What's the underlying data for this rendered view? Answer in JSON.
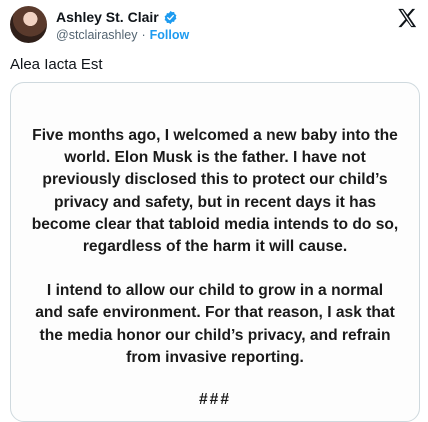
{
  "author": {
    "display_name": "Ashley St. Clair",
    "handle": "@stclairashley",
    "separator": "·",
    "follow_label": "Follow"
  },
  "tweet": {
    "text": "Alea Iacta Est"
  },
  "statement": {
    "paragraph_1": "Five months ago, I welcomed a new baby into the world. Elon Musk is the father. I have not previously disclosed this to protect our child’s privacy and safety, but in recent days it has become clear that tabloid media intends to do so, regardless of the harm it will cause.",
    "paragraph_2": "I intend to allow our child to grow in a normal and safe environment. For that reason, I ask that the media honor our child’s privacy, and refrain from invasive reporting.",
    "closing": "###"
  },
  "icons": {
    "verified": "verified-badge-icon",
    "platform": "x-logo-icon"
  },
  "colors": {
    "accent": "#1d9bf0",
    "text": "#0f1419",
    "muted": "#536471",
    "border": "#cfd9de"
  }
}
